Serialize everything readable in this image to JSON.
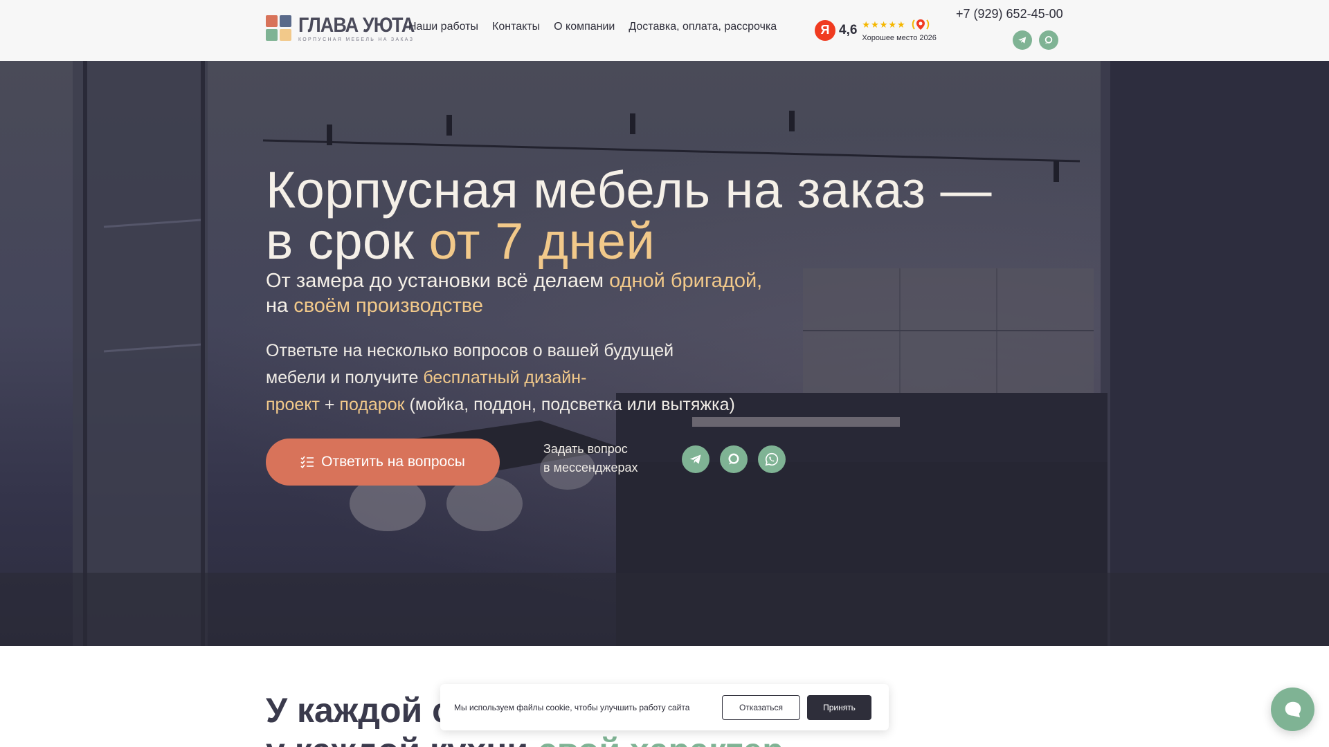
{
  "brand": {
    "name": "ГЛАВА УЮТА",
    "tagline": "КОРПУСНАЯ МЕБЕЛЬ НА ЗАКАЗ",
    "square_colors": [
      "#d8735a",
      "#5a6a8a",
      "#7fb394",
      "#f2c98a"
    ]
  },
  "nav": {
    "items": [
      "Наши работы",
      "Контакты",
      "О компании",
      "Доставка, оплата, рассрочка"
    ]
  },
  "rating": {
    "logo_letter": "Я",
    "value": "4,6",
    "stars": "★★★★★",
    "stars_filled": 4.6,
    "label": "Хорошее место 2026"
  },
  "contacts": {
    "phone": "+7 (929) 652-45-00",
    "header_icons": [
      "telegram-icon",
      "max-messenger-icon"
    ]
  },
  "hero": {
    "title_line1": "Корпусная мебель на заказ —",
    "title_line2_prefix": "в срок ",
    "title_line2_accent": "от 7 дней",
    "sub_line1_prefix": "От замера до установки всё делаем ",
    "sub_line1_accent": "одной бригадой,",
    "sub_line2_prefix": "на ",
    "sub_line2_accent": "своём производстве",
    "desc_line1": "Ответьте на несколько вопросов о вашей будущей",
    "desc_line2_prefix": "мебели и получите ",
    "desc_line2_accent": "бесплатный дизайн-",
    "desc_line3_accent1": "проект",
    "desc_line3_plus": " + ",
    "desc_line3_accent2": "подарок",
    "desc_line3_rest": " (мойка, поддон, подсветка или вытяжка)",
    "cta_label": "Ответить на вопросы",
    "ask_line1": "Задать вопрос",
    "ask_line2": "в мессенджерах",
    "messengers": [
      "telegram-icon",
      "max-messenger-icon",
      "whatsapp-icon"
    ]
  },
  "section": {
    "title_line1": "У каждой се",
    "title_line2_prefix": "у каждой кухни ",
    "title_line2_accent": "свой характер"
  },
  "cookie": {
    "text": "Мы используем файлы cookie, чтобы улучшить работу сайта",
    "decline": "Отказаться",
    "accept": "Принять"
  },
  "colors": {
    "accent_gold": "#f2c98a",
    "cta": "#d8735a",
    "messenger_green": "#7fb394",
    "dark": "#2e2e3a"
  }
}
